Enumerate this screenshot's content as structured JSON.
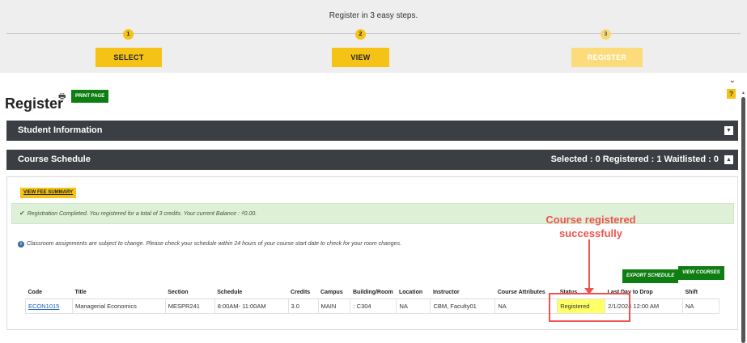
{
  "steps": {
    "title": "Register in 3 easy steps.",
    "items": [
      {
        "num": "1",
        "label": "SELECT"
      },
      {
        "num": "2",
        "label": "VIEW"
      },
      {
        "num": "3",
        "label": "REGISTER"
      }
    ]
  },
  "page": {
    "title": "Register",
    "print_label": "PRINT PAGE",
    "help_label": "?"
  },
  "student_info": {
    "label": "Student Information"
  },
  "course_schedule": {
    "label": "Course Schedule",
    "counts": "Selected : 0  Registered : 1  Waitlisted : 0"
  },
  "fee_summary_label": "VIEW FEE SUMMARY",
  "success_message": "Registration Completed. You registered for a total of 3 credits. Your current Balance : ₫0.00.",
  "info_message": "Classroom assignments are subject to change. Please check your schedule within 24 hours of your course start date to check for your room changes.",
  "annotation": {
    "line1": "Course registered",
    "line2": "successfully"
  },
  "buttons": {
    "export": "EXPORT SCHEDULE",
    "view_courses": "VIEW COURSES"
  },
  "table": {
    "headers": [
      "Code",
      "Title",
      "Section",
      "Schedule",
      "Credits",
      "Campus",
      "Building/Room",
      "Location",
      "Instructor",
      "Course Attributes",
      "Status",
      "Last Day to Drop",
      "Shift"
    ],
    "row": {
      "code": "ECON1015",
      "title": "Managerial Economics",
      "section": "MESPR241",
      "schedule": "8:00AM- 11:00AM",
      "credits": "3.0",
      "campus": "MAIN",
      "room": ": C304",
      "location": "NA",
      "instructor": "CBM, Faculty01",
      "attributes": "NA",
      "status": "Registered",
      "last_drop": "2/1/2024 12:00 AM",
      "shift": "NA"
    }
  },
  "colors": {
    "accent": "#f5c315",
    "green": "#0e7e13",
    "bar": "#3b3f44",
    "annotation": "#ef5350",
    "status_highlight": "#ffff66"
  }
}
